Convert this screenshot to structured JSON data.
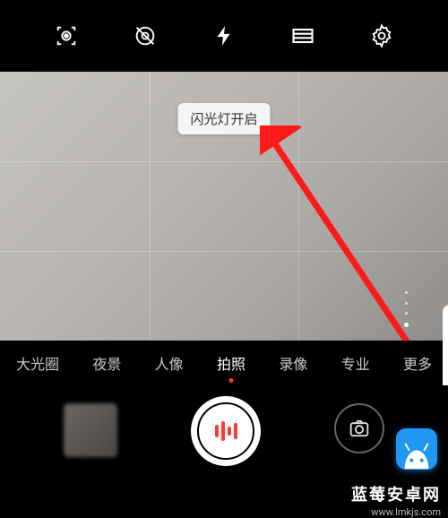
{
  "topbar": {
    "icons": [
      "lens-icon",
      "motion-off-icon",
      "flash-icon",
      "aspect-icon",
      "settings-icon"
    ]
  },
  "viewfinder": {
    "toast": "闪光灯开启"
  },
  "modes": {
    "items": [
      "大光圈",
      "夜景",
      "人像",
      "拍照",
      "录像",
      "专业",
      "更多"
    ],
    "active_index": 3
  },
  "watermark": {
    "brand": "蓝莓安卓网",
    "url": "www.lmkjs.com"
  }
}
